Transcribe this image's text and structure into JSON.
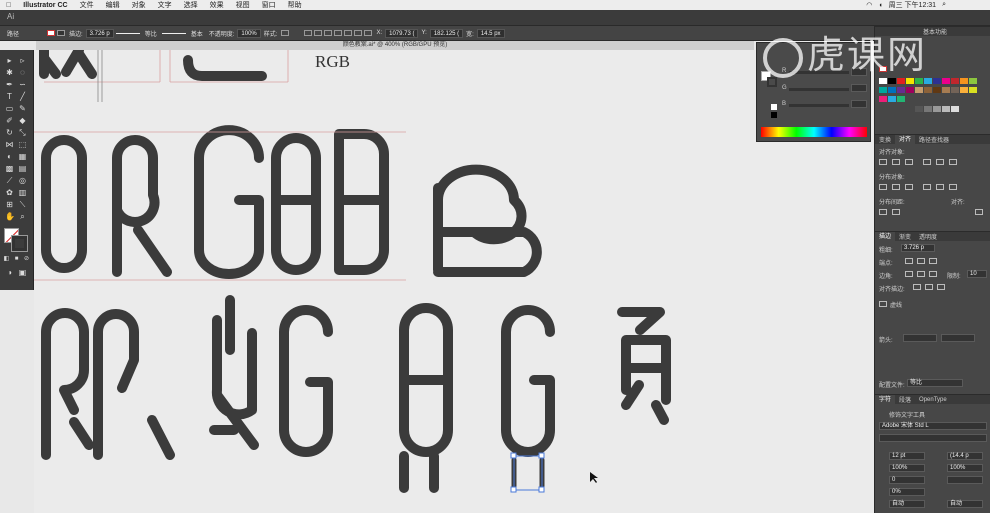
{
  "menubar": {
    "apple": "",
    "app_name": "Illustrator CC",
    "items": [
      "文件",
      "编辑",
      "对象",
      "文字",
      "选择",
      "效果",
      "视图",
      "窗口",
      "帮助"
    ],
    "clock": "周三 下午12:31"
  },
  "appbar": {
    "logo": "Ai"
  },
  "control": {
    "path_label": "路径",
    "stroke_label": "描边:",
    "stroke_value": "3.726 p",
    "profile_label": "等比",
    "brush_label": "基本",
    "opacity_label": "不透明度:",
    "opacity_value": "100%",
    "style_label": "样式:",
    "x_label": "X:",
    "x_value": "1079.73 (",
    "y_label": "Y:",
    "y_value": "182.125 (",
    "w_label": "宽:",
    "w_value": "14.5 px"
  },
  "document": {
    "tab_title": "颜色教案.ai* @ 400% (RGB/GPU 预览)"
  },
  "canvas": {
    "rgb_text": "RGB"
  },
  "color_panel": {
    "r": "R",
    "g": "G",
    "b": "B"
  },
  "right_dock": {
    "top_tabs": [
      "基本功能"
    ],
    "align_tabs": [
      "变换",
      "对齐",
      "路径查找器"
    ],
    "align_objects_label": "对齐对象:",
    "distribute_objects_label": "分布对象:",
    "distribute_spacing_label": "分布间距:",
    "align_to_label": "对齐:",
    "stroke_tabs": [
      "描边",
      "渐变",
      "透明度"
    ],
    "weight_label": "粗细:",
    "weight_value": "3.726 p",
    "cap_label": "端点:",
    "corner_label": "边角:",
    "limit_label": "限制:",
    "limit_value": "10",
    "align_stroke_label": "对齐描边:",
    "dashed_label": "虚线",
    "arrow_label": "箭头:",
    "profile_label": "配置文件:",
    "profile_value": "等比",
    "char_tabs": [
      "字符",
      "段落",
      "OpenType"
    ],
    "touch_type_label": "修饰文字工具",
    "font_name": "Adobe 宋体 Std L",
    "font_size": "12 pt",
    "leading": "(14.4 p",
    "h_scale": "100%",
    "v_scale": "100%",
    "tracking": "0",
    "kerning": "0%",
    "auto1": "自动",
    "auto2": "自动"
  },
  "watermark": {
    "text": "虎课网"
  }
}
